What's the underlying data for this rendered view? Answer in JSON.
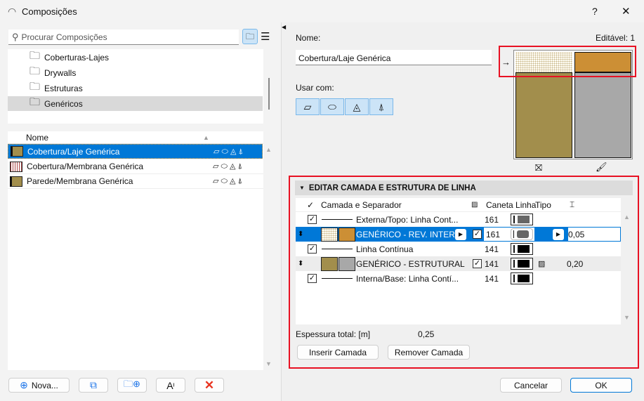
{
  "window": {
    "title": "Composições",
    "help": "?",
    "close": "✕"
  },
  "search": {
    "placeholder": "Procurar Composições"
  },
  "folders": [
    "Coberturas-Lajes",
    "Drywalls",
    "Estruturas",
    "Genéricos"
  ],
  "list": {
    "header": "Nome",
    "items": [
      "Cobertura/Laje Genérica",
      "Cobertura/Membrana Genérica",
      "Parede/Membrana Genérica"
    ],
    "selected": 0
  },
  "left_buttons": {
    "new": "Nova..."
  },
  "editor": {
    "name_label": "Nome:",
    "name_value": "Cobertura/Laje Genérica",
    "editable": "Editável: 1",
    "use_with": "Usar com:"
  },
  "colors": {
    "accent": "#0078d7",
    "selection_border": "#e81123",
    "finish": "#cc8f35",
    "structure": "#a8a8a8"
  },
  "layers": {
    "section_title": "EDITAR CAMADA E ESTRUTURA DE LINHA",
    "columns": [
      "Camada e Separador",
      "Caneta Linha",
      "Tipo"
    ],
    "rows": [
      {
        "kind": "line",
        "checked": true,
        "name": "Externa/Topo: Linha Cont...",
        "pen": "161"
      },
      {
        "kind": "layer",
        "name": "GENÉRICO - REV.  INTER...",
        "checked": true,
        "pen": "161",
        "thickness": "0,05",
        "selected": true
      },
      {
        "kind": "line",
        "checked": true,
        "name": "Linha Contínua",
        "pen": "141"
      },
      {
        "kind": "layer",
        "name": "GENÉRICO - ESTRUTURAL",
        "checked": true,
        "pen": "141",
        "thickness": "0,20"
      },
      {
        "kind": "line",
        "checked": true,
        "name": "Interna/Base: Linha Contí...",
        "pen": "141"
      }
    ],
    "total_label": "Espessura total: [m]",
    "total_value": "0,25",
    "insert": "Inserir Camada",
    "remove": "Remover Camada"
  },
  "footer": {
    "cancel": "Cancelar",
    "ok": "OK"
  }
}
